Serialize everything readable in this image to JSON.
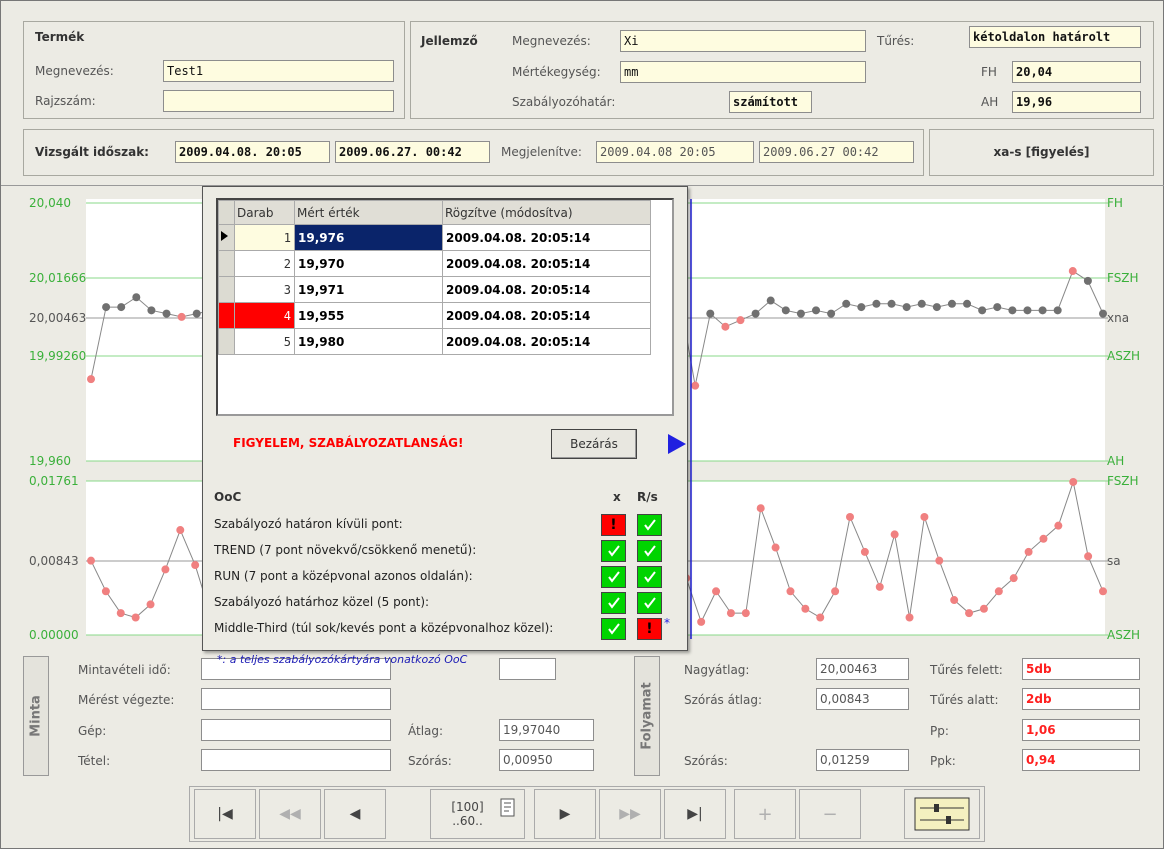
{
  "product": {
    "title": "Termék",
    "name_label": "Megnevezés:",
    "name_value": "Test1",
    "drawing_label": "Rajzszám:",
    "drawing_value": ""
  },
  "characteristic": {
    "title": "Jellemző",
    "name_label": "Megnevezés:",
    "name_value": "Xi",
    "unit_label": "Mértékegység:",
    "unit_value": "mm",
    "limit_label": "Szabályozóhatár:",
    "limit_value": "számított",
    "tol_label": "Tűrés:",
    "tol_value": "kétoldalon határolt",
    "fh_label": "FH",
    "fh_value": "20,04",
    "ah_label": "AH",
    "ah_value": "19,96"
  },
  "period": {
    "label": "Vizsgált időszak:",
    "from": "2009.04.08. 20:05",
    "to": "2009.06.27. 00:42",
    "shown_label": "Megjelenítve:",
    "shown_from": "2009.04.08 20:05",
    "shown_to": "2009.06.27 00:42",
    "mode": "xa-s [figyelés]"
  },
  "chart_data": [
    {
      "type": "line",
      "title": "",
      "y_tick_labels": [
        "20,040",
        "20,01666",
        "20,00463",
        "19,99260",
        "19,960"
      ],
      "right_labels": [
        "FH",
        "FSZH",
        "xna",
        "ASZH",
        "AH"
      ],
      "ylim": [
        19.96,
        20.04
      ],
      "series": [
        {
          "values": [
            19.985,
            20.007,
            20.007,
            20.01,
            20.006,
            20.005,
            20.004,
            20.005,
            20.006,
            20.006,
            20.036,
            null,
            null,
            null,
            null,
            null,
            null,
            null,
            null,
            null,
            null,
            null,
            null,
            null,
            null,
            null,
            null,
            null,
            null,
            null,
            20.019,
            20.015,
            20.01,
            20.006,
            20.007,
            20.008,
            20.01,
            20.005,
            20.005,
            20.009,
            19.983,
            20.005,
            20.001,
            20.003,
            20.005,
            20.009,
            20.006,
            20.005,
            20.006,
            20.005,
            20.008,
            20.007,
            20.008,
            20.008,
            20.007,
            20.008,
            20.007,
            20.008,
            20.008,
            20.006,
            20.007,
            20.006,
            20.006,
            20.006,
            20.006,
            20.018,
            20.015,
            20.005
          ]
        }
      ]
    },
    {
      "type": "line",
      "title": "",
      "y_tick_labels": [
        "0,01761",
        "0,00843",
        "0,00000"
      ],
      "right_labels": [
        "FSZH",
        "sa",
        "ASZH"
      ],
      "ylim": [
        0,
        0.01761
      ],
      "series": [
        {
          "values": [
            0.0085,
            0.005,
            0.0025,
            0.002,
            0.0035,
            0.0075,
            0.012,
            0.008,
            0.0025,
            0.01,
            0.013,
            null,
            null,
            null,
            null,
            null,
            null,
            null,
            null,
            null,
            null,
            null,
            null,
            null,
            null,
            null,
            null,
            null,
            null,
            null,
            0.0115,
            0.005,
            0.0155,
            0.01,
            0.003,
            0.0075,
            0.0025,
            0.0015,
            0.003,
            0.006,
            0.0065,
            0.0015,
            0.005,
            0.0025,
            0.0025,
            0.0145,
            0.01,
            0.005,
            0.003,
            0.002,
            0.005,
            0.0135,
            0.0095,
            0.0055,
            0.0115,
            0.002,
            0.0135,
            0.0085,
            0.004,
            0.0025,
            0.003,
            0.005,
            0.0065,
            0.0095,
            0.011,
            0.0125,
            0.0175,
            0.009,
            0.005
          ]
        }
      ]
    }
  ],
  "popup": {
    "headers": [
      "Darab",
      "Mért érték",
      "Rögzítve (módosítva)"
    ],
    "rows": [
      {
        "n": "1",
        "value": "19,976",
        "ts": "2009.04.08. 20:05:14"
      },
      {
        "n": "2",
        "value": "19,970",
        "ts": "2009.04.08. 20:05:14"
      },
      {
        "n": "3",
        "value": "19,971",
        "ts": "2009.04.08. 20:05:14"
      },
      {
        "n": "4",
        "value": "19,955",
        "ts": "2009.04.08. 20:05:14"
      },
      {
        "n": "5",
        "value": "19,980",
        "ts": "2009.04.08. 20:05:14"
      }
    ],
    "warning": "FIGYELEM, SZABÁLYOZATLANSÁG!",
    "close_label": "Bezárás",
    "ooc_title": "OoC",
    "col_x": "x",
    "col_rs": "R/s",
    "rules": [
      {
        "label": "Szabályozó határon kívüli pont:",
        "x": "fail",
        "rs": "ok"
      },
      {
        "label": "TREND (7 pont növekvő/csökkenő menetű):",
        "x": "ok",
        "rs": "ok"
      },
      {
        "label": "RUN (7 pont a középvonal azonos oldalán):",
        "x": "ok",
        "rs": "ok"
      },
      {
        "label": "Szabályozó határhoz közel (5 pont):",
        "x": "ok",
        "rs": "ok"
      },
      {
        "label": "Middle-Third (túl sok/kevés pont a középvonalhoz közel):",
        "x": "ok",
        "rs": "fail"
      }
    ],
    "star": "*",
    "footnote": "*: a teljes szabályozókártyára vonatkozó OoC"
  },
  "sample": {
    "tab": "Minta",
    "time_label": "Mintavételi idő:",
    "by_label": "Mérést végezte:",
    "machine_label": "Gép:",
    "item_label": "Tétel:",
    "avg_label": "Átlag:",
    "avg_value": "19,97040",
    "sd_label": "Szórás:",
    "sd_value": "0,00950"
  },
  "process": {
    "tab": "Folyamat",
    "grand_label": "Nagyátlag:",
    "grand_value": "20,00463",
    "sdavg_label": "Szórás átlag:",
    "sdavg_value": "0,00843",
    "sd_label": "Szórás:",
    "sd_value": "0,01259",
    "above_label": "Tűrés felett:",
    "above_value": "5db",
    "below_label": "Tűrés alatt:",
    "below_value": "2db",
    "pp_label": "Pp:",
    "pp_value": "1,06",
    "ppk_label": "Ppk:",
    "ppk_value": "0,94"
  },
  "nav": {
    "first": "|◀",
    "prev_page": "◀◀",
    "prev": "◀",
    "counter_top": "[100]",
    "counter_bottom": "..60..",
    "next": "▶",
    "next_page": "▶▶",
    "last": "▶|",
    "add": "+",
    "remove": "−"
  },
  "colors": {
    "limit_line": "#88d888",
    "center_line": "#999999",
    "point_ok": "#707070",
    "point_oc": "#f08080",
    "cursor": "#2020e0"
  }
}
